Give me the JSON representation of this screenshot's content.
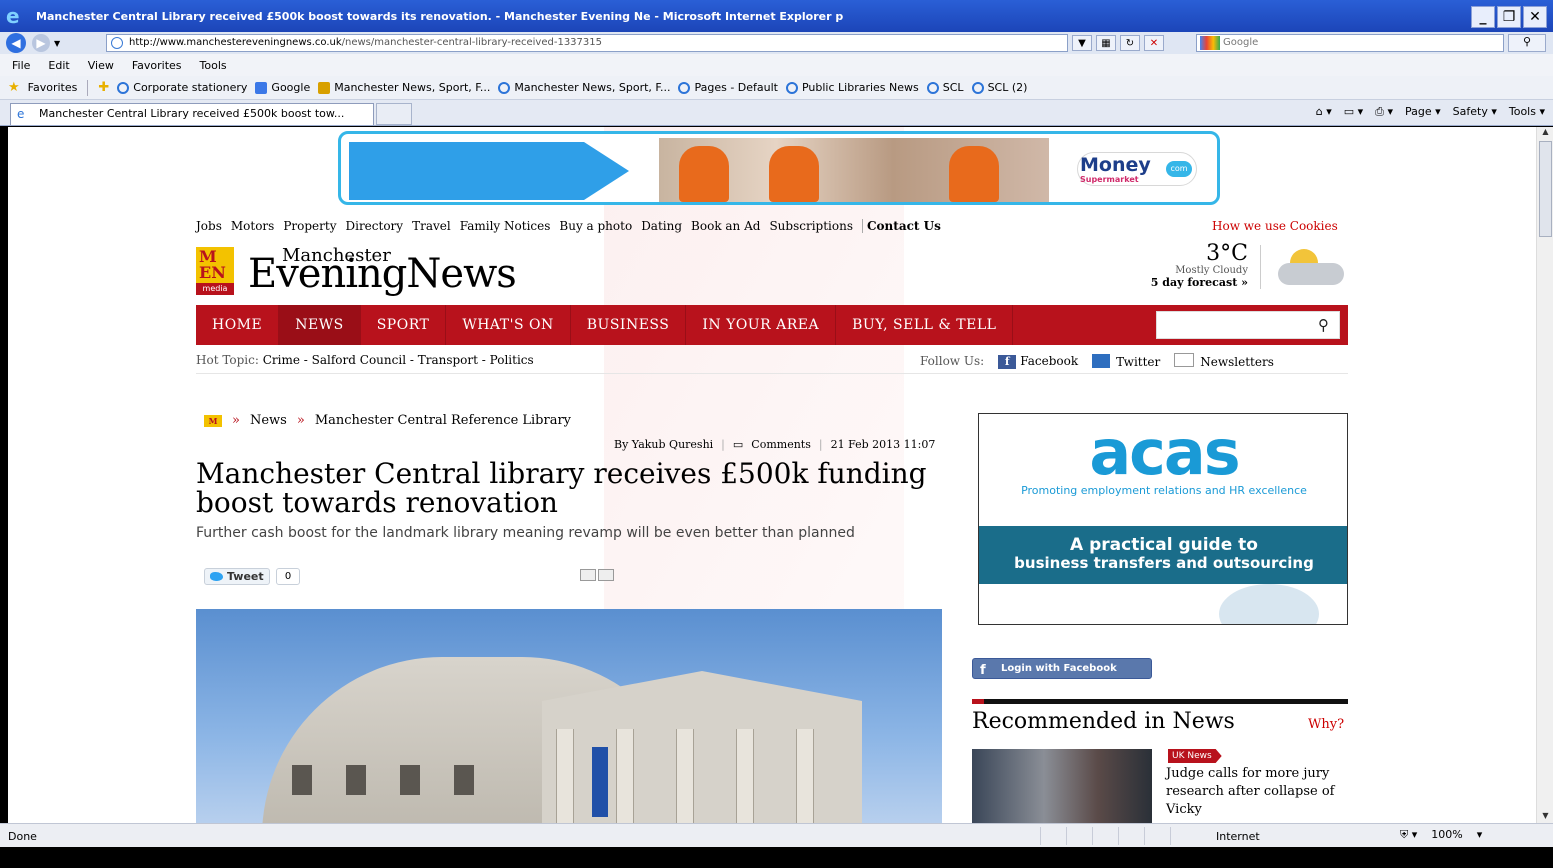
{
  "window": {
    "title": "Manchester Central Library received £500k boost towards its renovation. - Manchester Evening Ne - Microsoft Internet Explorer p",
    "min": "_",
    "max": "❐",
    "close": "✕"
  },
  "address": {
    "url_domain": "http://www.manchestereveningnews.co.uk",
    "url_path": "/news/manchester-central-library-received-1337315",
    "search_placeholder": "Google"
  },
  "menu": [
    "File",
    "Edit",
    "View",
    "Favorites",
    "Tools"
  ],
  "favorites": {
    "label": "Favorites",
    "items": [
      "Corporate stationery",
      "Google",
      "Manchester News, Sport, F...",
      "Manchester News, Sport, F...",
      "Pages - Default",
      "Public Libraries News",
      "SCL",
      "SCL (2)"
    ]
  },
  "tab": {
    "title": "Manchester Central Library received £500k boost tow..."
  },
  "commandbar": [
    "Page ▾",
    "Safety ▾",
    "Tools ▾"
  ],
  "status": {
    "left": "Done",
    "zone": "Internet",
    "zoom": "100%"
  },
  "page": {
    "ad_banner": {
      "logo": "Money",
      "logo_sub": "Supermarket",
      "logo_com": "com"
    },
    "toplinks": [
      "Jobs",
      "Motors",
      "Property",
      "Directory",
      "Travel",
      "Family Notices",
      "Buy a photo",
      "Dating",
      "Book an Ad",
      "Subscriptions"
    ],
    "contact": "Contact Us",
    "cookies": "How we use Cookies",
    "logo": {
      "letters": "M\nEN",
      "media": "media",
      "small": "Manchester",
      "big": "EveningNews"
    },
    "weather": {
      "temp": "3°C",
      "desc": "Mostly Cloudy",
      "forecast": "5 day forecast »"
    },
    "nav": [
      "HOME",
      "NEWS",
      "SPORT",
      "WHAT'S ON",
      "BUSINESS",
      "IN YOUR AREA",
      "BUY, SELL & TELL"
    ],
    "hot": {
      "label": "Hot Topic:",
      "topics": "Crime - Salford Council - Transport - Politics"
    },
    "follow": {
      "label": "Follow Us:",
      "facebook": "Facebook",
      "twitter": "Twitter",
      "newsletters": "Newsletters"
    },
    "breadcrumb": {
      "home": "M",
      "news": "News",
      "section": "Manchester Central Reference Library"
    },
    "byline": {
      "author": "By Yakub Qureshi",
      "comments": "Comments",
      "date": "21 Feb 2013 11:07"
    },
    "headline": "Manchester Central library receives £500k funding boost towards renovation",
    "standfirst": "Further cash boost for the landmark library meaning revamp will be even better than planned",
    "tweet": {
      "label": "Tweet",
      "count": "0"
    },
    "acas": {
      "logo": "acas",
      "tagline": "Promoting employment relations and HR excellence",
      "line1": "A practical guide to",
      "line2": "business transfers and outsourcing"
    },
    "fb_login": "Login with Facebook",
    "recommended": {
      "title": "Recommended in News",
      "why": "Why?",
      "badge": "UK News",
      "headline": "Judge calls for more jury research after collapse of Vicky"
    }
  }
}
